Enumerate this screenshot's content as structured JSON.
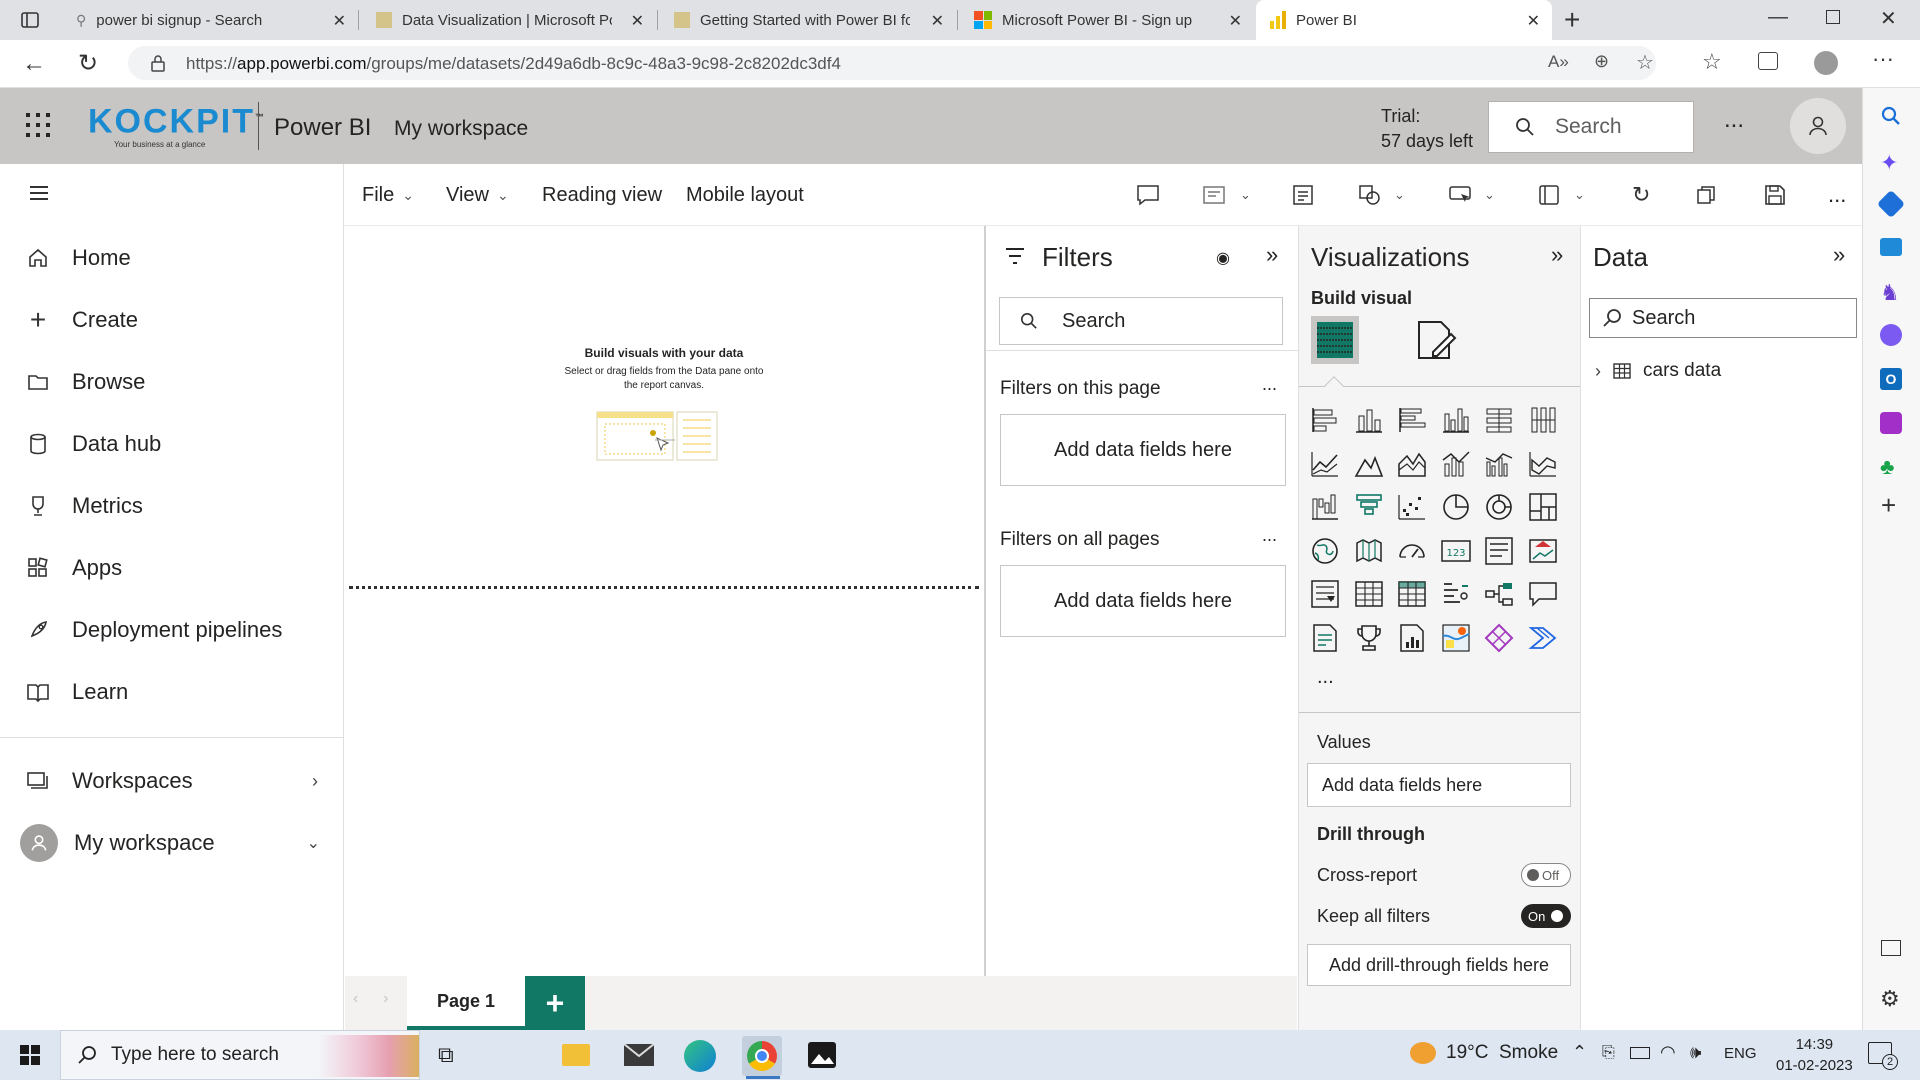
{
  "browser": {
    "tabs": [
      {
        "title": "power bi signup - Search"
      },
      {
        "title": "Data Visualization | Microsoft Po"
      },
      {
        "title": "Getting Started with Power BI for"
      },
      {
        "title": "Microsoft Power BI - Sign up"
      },
      {
        "title": "Power BI"
      }
    ],
    "url_prefix": "https://",
    "url_host": "app.powerbi.com",
    "url_path": "/groups/me/datasets/2d49a6db-8c9c-48a3-9c98-2c8202dc3df4"
  },
  "header": {
    "logo_text": "KOCKPIT",
    "logo_tm": "™",
    "logo_tagline": "Your business at a glance",
    "app_name": "Power BI",
    "workspace": "My workspace",
    "trial_line1": "Trial:",
    "trial_line2": "57 days left",
    "search_placeholder": "Search",
    "more": "..."
  },
  "nav": {
    "items": [
      {
        "label": "Home",
        "icon": "home-icon"
      },
      {
        "label": "Create",
        "icon": "plus-icon"
      },
      {
        "label": "Browse",
        "icon": "folder-icon"
      },
      {
        "label": "Data hub",
        "icon": "database-icon"
      },
      {
        "label": "Metrics",
        "icon": "trophy-icon"
      },
      {
        "label": "Apps",
        "icon": "apps-icon"
      },
      {
        "label": "Deployment pipelines",
        "icon": "rocket-icon"
      },
      {
        "label": "Learn",
        "icon": "book-icon"
      }
    ],
    "workspaces": "Workspaces",
    "my_workspace": "My workspace"
  },
  "ribbon": {
    "file": "File",
    "view": "View",
    "reading_view": "Reading view",
    "mobile_layout": "Mobile layout",
    "more": "..."
  },
  "canvas": {
    "empty_title": "Build visuals with your data",
    "empty_body_1": "Select or drag fields from the Data pane onto",
    "empty_body_2": "the report canvas."
  },
  "pages": {
    "current": "Page 1",
    "add": "+"
  },
  "filters": {
    "title": "Filters",
    "search_placeholder": "Search",
    "on_this_page": "Filters on this page",
    "on_all_pages": "Filters on all pages",
    "add_fields": "Add data fields here",
    "more": "..."
  },
  "visualizations": {
    "title": "Visualizations",
    "build_visual": "Build visual",
    "more": "...",
    "values": "Values",
    "values_add": "Add data fields here",
    "drill_through": "Drill through",
    "cross_report": "Cross-report",
    "cross_report_state": "Off",
    "keep_all_filters": "Keep all filters",
    "keep_all_filters_state": "On",
    "drill_add": "Add drill-through fields here",
    "icons": [
      "stacked-bar-icon",
      "stacked-column-icon",
      "clustered-bar-icon",
      "clustered-column-icon",
      "100-bar-icon",
      "100-column-icon",
      "line-chart-icon",
      "area-chart-icon",
      "stacked-area-icon",
      "line-column-icon",
      "line-clustered-column-icon",
      "ribbon-chart-icon",
      "waterfall-icon",
      "funnel-icon",
      "scatter-icon",
      "pie-icon",
      "donut-icon",
      "treemap-icon",
      "map-icon",
      "filled-map-icon",
      "gauge-icon",
      "card-icon",
      "multirow-card-icon",
      "kpi-icon",
      "slicer-icon",
      "table-icon",
      "matrix-icon",
      "key-influencers-icon",
      "decomposition-tree-icon",
      "qna-icon",
      "smart-narrative-icon",
      "goals-icon",
      "paginated-report-icon",
      "azure-map-icon",
      "power-apps-icon",
      "power-automate-icon"
    ]
  },
  "data": {
    "title": "Data",
    "search_placeholder": "Search",
    "table_name": "cars data"
  },
  "taskbar": {
    "search_placeholder": "Type here to search",
    "weather": "19°C  Smoke",
    "lang": "ENG",
    "time": "14:39",
    "date": "01-02-2023",
    "notif_count": "2"
  },
  "colors": {
    "header_bg": "#c8c6c4",
    "accent_green": "#117865",
    "logo_blue": "#1a8bd1"
  }
}
